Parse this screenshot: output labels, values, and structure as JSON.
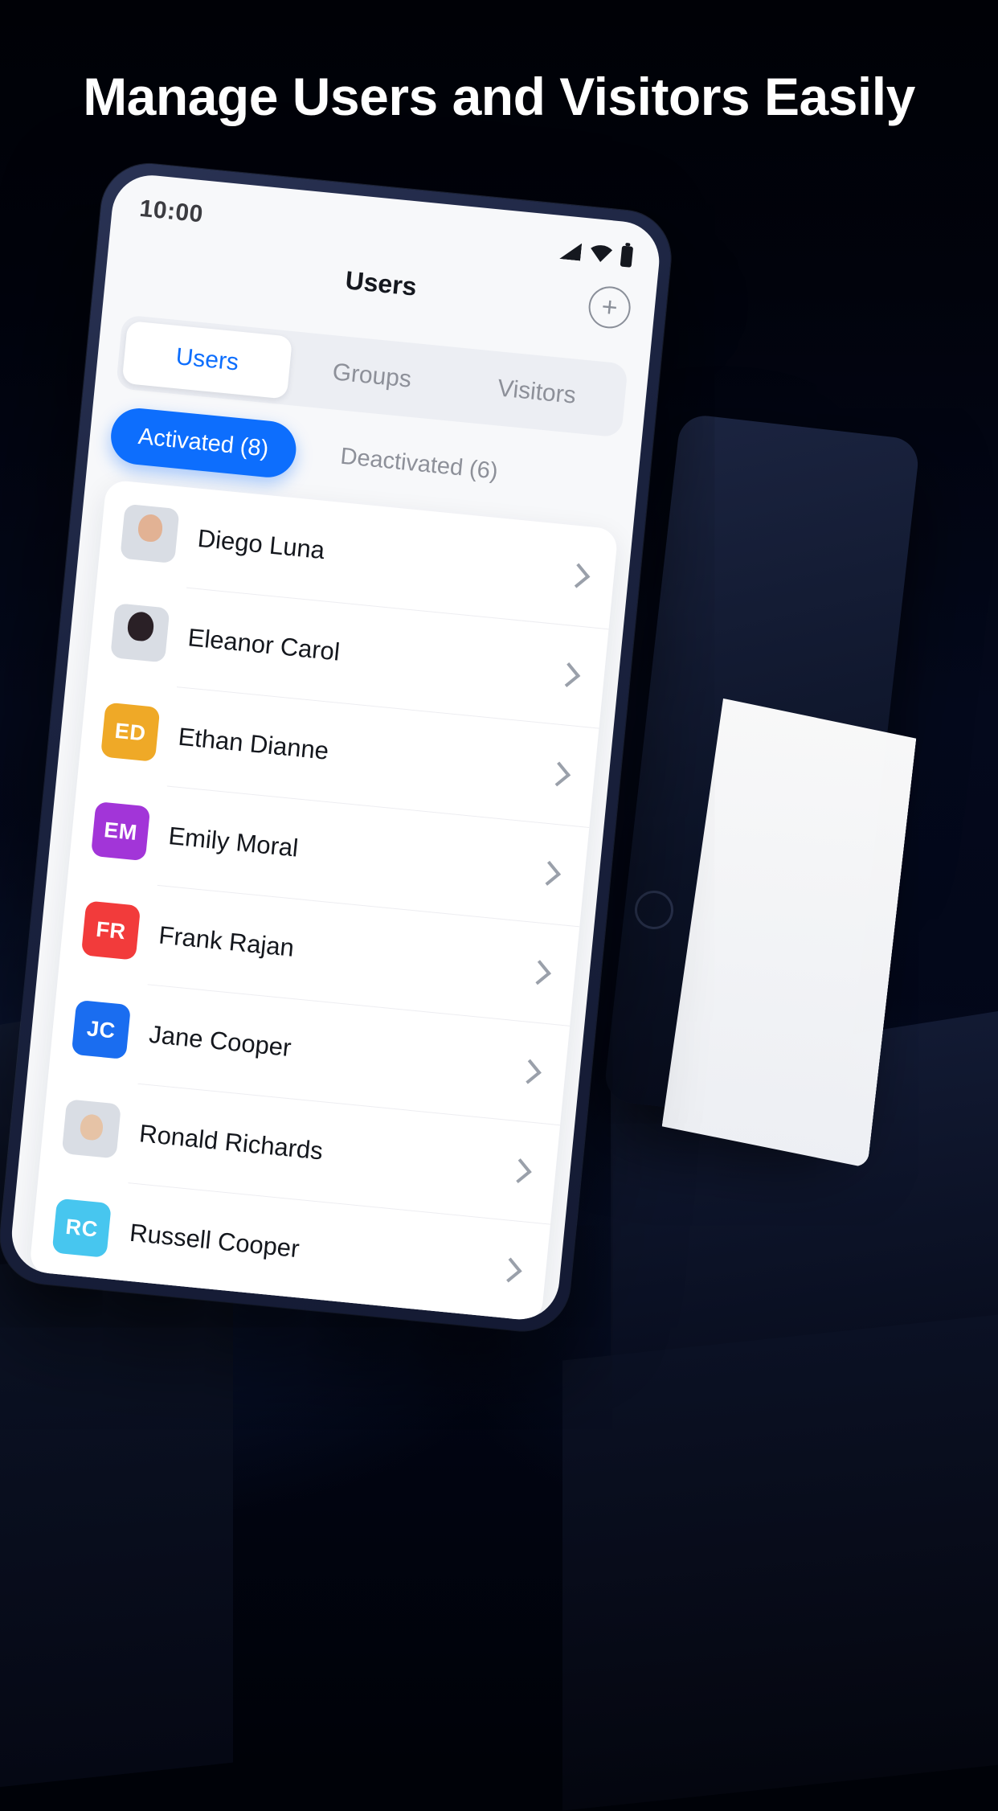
{
  "headline": "Manage Users and Visitors Easily",
  "theme": {
    "background": "#000208",
    "accent": "#0d6efd",
    "phone_frame": "#1b2340",
    "screen_bg": "#f7f8fa"
  },
  "phone": {
    "statusbar": {
      "time": "10:00",
      "icons": [
        "signal-icon",
        "wifi-icon",
        "battery-icon"
      ]
    },
    "nav": {
      "title": "Users",
      "add_label": "+"
    },
    "tabs": [
      {
        "label": "Users",
        "active": true
      },
      {
        "label": "Groups",
        "active": false
      },
      {
        "label": "Visitors",
        "active": false
      }
    ],
    "filters": [
      {
        "label": "Activated (8)",
        "active": true
      },
      {
        "label": "Deactivated (6)",
        "active": false
      }
    ],
    "users": [
      {
        "name": "Diego Luna",
        "avatar_type": "photo",
        "initials": "",
        "color": "#d9dde4",
        "photo_class": "f1"
      },
      {
        "name": "Eleanor Carol",
        "avatar_type": "photo",
        "initials": "",
        "color": "#f3cfc8",
        "photo_class": "f2"
      },
      {
        "name": "Ethan Dianne",
        "avatar_type": "initials",
        "initials": "ED",
        "color": "#efa927",
        "photo_class": ""
      },
      {
        "name": "Emily Moral",
        "avatar_type": "initials",
        "initials": "EM",
        "color": "#a235d8",
        "photo_class": ""
      },
      {
        "name": "Frank Rajan",
        "avatar_type": "initials",
        "initials": "FR",
        "color": "#f23b3b",
        "photo_class": ""
      },
      {
        "name": "Jane Cooper",
        "avatar_type": "initials",
        "initials": "JC",
        "color": "#1a6df0",
        "photo_class": ""
      },
      {
        "name": "Ronald Richards",
        "avatar_type": "photo",
        "initials": "",
        "color": "#1d3420",
        "photo_class": "f3"
      },
      {
        "name": "Russell Cooper",
        "avatar_type": "initials",
        "initials": "RC",
        "color": "#47c6ef",
        "photo_class": ""
      }
    ],
    "row_chevron": "chevron-right-icon"
  }
}
